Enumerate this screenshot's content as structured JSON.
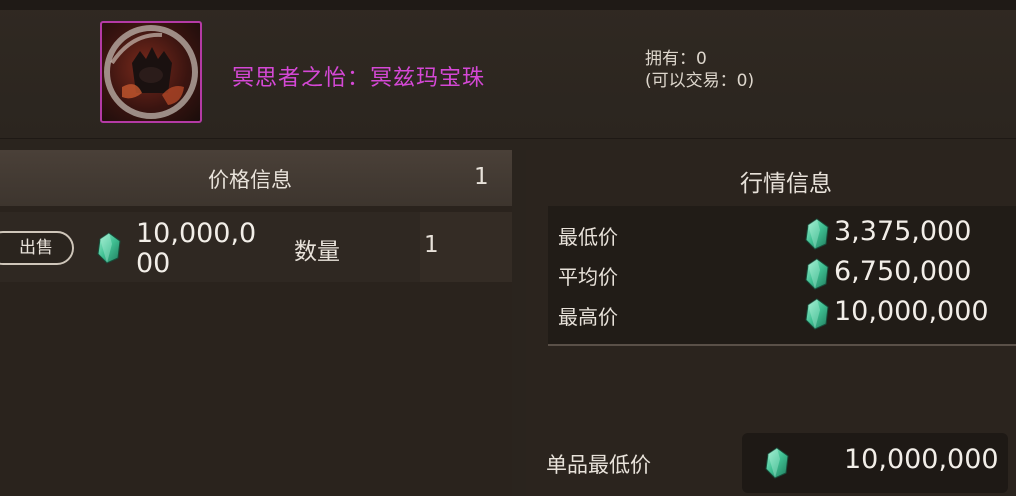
{
  "item": {
    "name": "冥思者之怡：冥兹玛宝珠",
    "owned": "拥有：0",
    "tradable": "(可以交易：0)"
  },
  "price_info": {
    "title": "价格信息",
    "count": "1",
    "sell_label": "出售",
    "price": "10,000,000",
    "qty_label": "数量",
    "qty_value": "1"
  },
  "market_info": {
    "title": "行情信息",
    "rows": [
      {
        "label": "最低价",
        "value": "3,375,000"
      },
      {
        "label": "平均价",
        "value": "6,750,000"
      },
      {
        "label": "最高价",
        "value": "10,000,000"
      }
    ],
    "unit_min_label": "单品最低价",
    "unit_min_value": "10,000,000"
  },
  "colors": {
    "item_name": "#d548d6",
    "gem": "#4fc9a0"
  },
  "icons": {
    "item": "demon-orb-icon",
    "currency": "green-gem-icon"
  }
}
